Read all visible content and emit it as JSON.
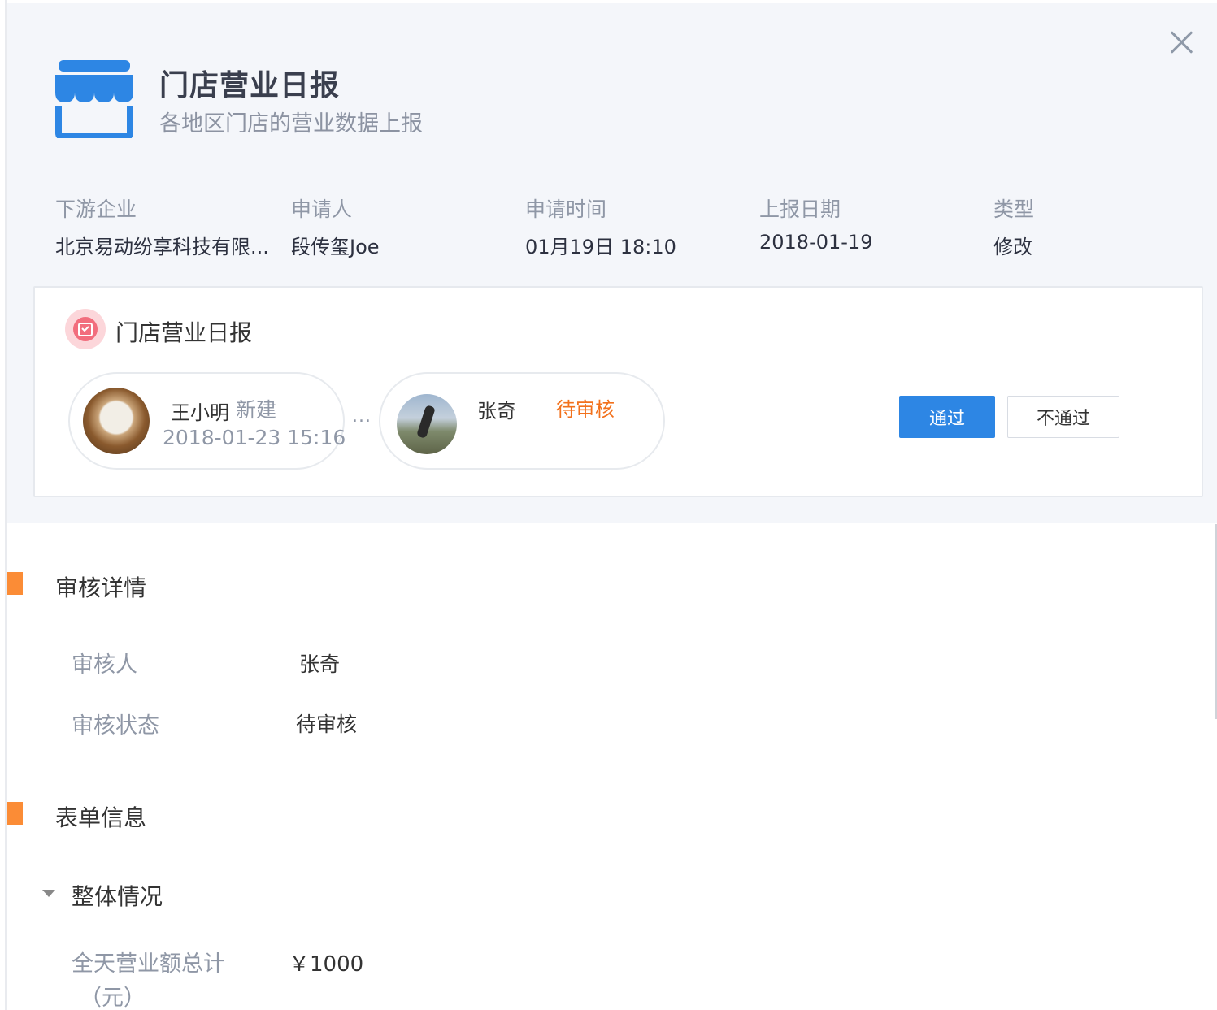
{
  "header": {
    "title": "门店营业日报",
    "subtitle": "各地区门店的营业数据上报"
  },
  "meta": {
    "downstream_label": "下游企业",
    "downstream_value": "北京易动纷享科技有限...",
    "applicant_label": "申请人",
    "applicant_value": "段传玺Joe",
    "apply_time_label": "申请时间",
    "apply_time_value": "01月19日 18:10",
    "report_date_label": "上报日期",
    "report_date_value": "2018-01-19",
    "type_label": "类型",
    "type_value": "修改"
  },
  "flow": {
    "card_title": "门店营业日报",
    "ellipsis": "...",
    "node1": {
      "name": "王小明",
      "action": "新建",
      "time": "2018-01-23 15:16"
    },
    "node2": {
      "name": "张奇",
      "status": "待审核"
    },
    "pass_label": "通过",
    "reject_label": "不通过"
  },
  "review": {
    "section_title": "审核详情",
    "reviewer_label": "审核人",
    "reviewer_value": "张奇",
    "status_label": "审核状态",
    "status_value": "待审核"
  },
  "form": {
    "section_title": "表单信息",
    "group_title": "整体情况",
    "field_label": "全天营业额总计",
    "field_unit": "（元）",
    "field_value": "￥1000"
  },
  "colors": {
    "accent_blue": "#2d86e4",
    "section_orange": "#fb8c36",
    "pending_orange": "#f2711c"
  }
}
